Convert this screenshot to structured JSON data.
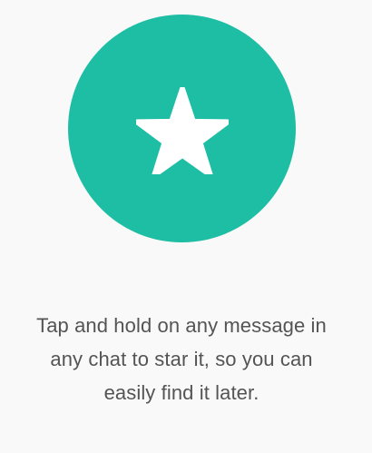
{
  "starred_empty_state": {
    "icon": "star-icon",
    "circle_color": "#1ebea5",
    "icon_color": "#ffffff",
    "message": "Tap and hold on any message in any chat to star it, so you can easily find it later."
  }
}
